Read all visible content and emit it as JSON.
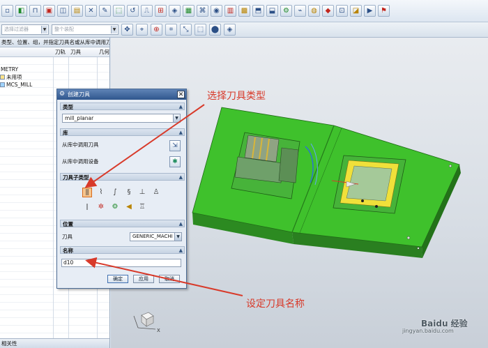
{
  "toolbar_row2": {
    "filter_left": "选择过滤器",
    "filter_right": "整个装配"
  },
  "navigator": {
    "header": "类型、位置、组，并指定刀具名或从库中调用刀具",
    "col_name": "",
    "col_path": "刀轨",
    "col_tool": "刀具",
    "col_geom": "几何",
    "rows": [
      {
        "label": "METRY"
      },
      {
        "label": "未用项"
      },
      {
        "label": "MCS_MILL"
      }
    ],
    "footer": "相关性"
  },
  "dialog": {
    "title": "创建刀具",
    "type_section": "类型",
    "type_value": "mill_planar",
    "library_section": "库",
    "library_tool_label": "从库中调用刀具",
    "library_device_label": "从库中调用设备",
    "subtype_section": "刀具子类型",
    "location_section": "位置",
    "tool_label": "刀具",
    "tool_value": "GENERIC_MACHI",
    "name_section": "名称",
    "name_value": "d10",
    "ok_label": "确定",
    "apply_label": "应用",
    "cancel_label": "取消"
  },
  "annotations": {
    "select_type": "选择刀具类型",
    "set_name": "设定刀具名称"
  },
  "watermark": {
    "brand": "Baidu 经验",
    "url": "jingyan.baidu.com"
  },
  "colors": {
    "annotation_red": "#d83a2a",
    "model_green": "#3fc12c",
    "title_blue": "#2f568d"
  }
}
